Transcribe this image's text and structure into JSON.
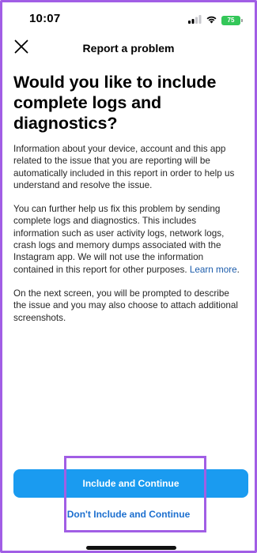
{
  "status_bar": {
    "time": "10:07",
    "battery_level": "75",
    "signal_icon": "cellular-signal-icon",
    "wifi_icon": "wifi-icon",
    "battery_color": "#34c759"
  },
  "nav": {
    "title": "Report a problem",
    "close_icon": "close-icon"
  },
  "content": {
    "headline": "Would you like to include complete logs and diagnostics?",
    "paragraph1": "Information about your device, account and this app related to the issue that you are reporting will be automatically included in this report in order to help us understand and resolve the issue.",
    "paragraph2": "You can further help us fix this problem by sending complete logs and diagnostics. This includes information such as user activity logs, network logs, crash logs and memory dumps associated with the Instagram app. We will not use the information contained in this report for other purposes.",
    "learn_more": "Learn more",
    "learn_more_suffix": ".",
    "paragraph3": "On the next screen, you will be prompted to describe the issue and you may also choose to attach additional screenshots."
  },
  "actions": {
    "primary_label": "Include and Continue",
    "secondary_label": "Don't Include and Continue",
    "primary_color": "#1a9bf0",
    "link_color": "#1c6fcf"
  },
  "annotation": {
    "highlight_color": "#a15ee5"
  }
}
